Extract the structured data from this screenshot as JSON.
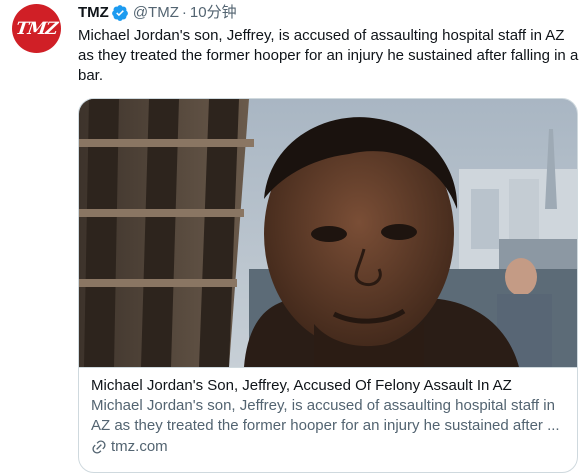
{
  "tweet": {
    "author": {
      "display_name": "TMZ",
      "handle": "@TMZ",
      "avatar_text": "TMZ",
      "verified": true
    },
    "separator": "·",
    "timestamp": "10分钟",
    "text": "Michael Jordan's son, Jeffrey, is accused of assaulting hospital staff in AZ as they treated the former hooper for an injury he sustained after falling in a bar.",
    "card": {
      "title": "Michael Jordan's Son, Jeffrey, Accused Of Felony Assault In AZ",
      "description": "Michael Jordan's son, Jeffrey, is accused of assaulting hospital staff in AZ as they treated the former hooper for an injury he sustained after ...",
      "domain": "tmz.com",
      "image_icon": "photo-of-man-selfie"
    }
  },
  "colors": {
    "text_primary": "#0f1419",
    "text_secondary": "#536471",
    "verified_blue": "#1d9bf0",
    "avatar_red": "#d01f26",
    "border": "#cfd9de"
  }
}
